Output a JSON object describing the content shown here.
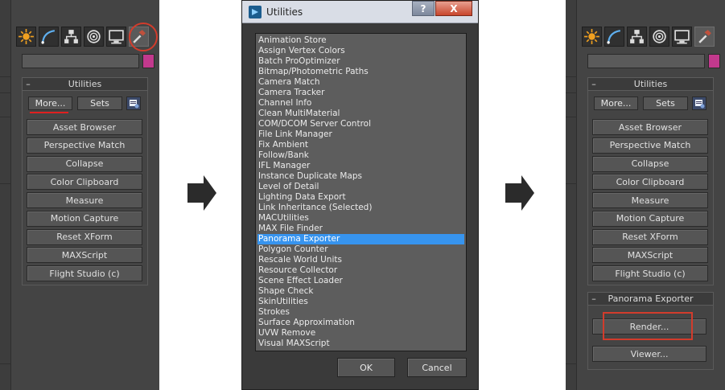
{
  "panel_left": {
    "rollout_title": "Utilities",
    "more_label": "More...",
    "sets_label": "Sets",
    "buttons": [
      "Asset Browser",
      "Perspective Match",
      "Collapse",
      "Color Clipboard",
      "Measure",
      "Motion Capture",
      "Reset XForm",
      "MAXScript",
      "Flight Studio (c)"
    ]
  },
  "dialog": {
    "title": "Utilities",
    "help_label": "?",
    "close_label": "X",
    "items": [
      "Animation Store",
      "Assign Vertex Colors",
      "Batch ProOptimizer",
      "Bitmap/Photometric Paths",
      "Camera Match",
      "Camera Tracker",
      "Channel Info",
      "Clean MultiMaterial",
      "COM/DCOM Server Control",
      "File Link Manager",
      "Fix Ambient",
      "Follow/Bank",
      "IFL Manager",
      "Instance Duplicate Maps",
      "Level of Detail",
      "Lighting Data Export",
      "Link Inheritance (Selected)",
      "MACUtilities",
      "MAX File Finder",
      "Panorama Exporter",
      "Polygon Counter",
      "Rescale World Units",
      "Resource Collector",
      "Scene Effect Loader",
      "Shape Check",
      "SkinUtilities",
      "Strokes",
      "Surface Approximation",
      "UVW Remove",
      "Visual MAXScript"
    ],
    "selected_item": "Panorama Exporter",
    "ok_label": "OK",
    "cancel_label": "Cancel"
  },
  "panel_right": {
    "rollout_title": "Utilities",
    "more_label": "More...",
    "sets_label": "Sets",
    "buttons": [
      "Asset Browser",
      "Perspective Match",
      "Collapse",
      "Color Clipboard",
      "Measure",
      "Motion Capture",
      "Reset XForm",
      "MAXScript",
      "Flight Studio (c)"
    ],
    "panorama_title": "Panorama Exporter",
    "render_label": "Render...",
    "viewer_label": "Viewer..."
  },
  "colors": {
    "panel_bg": "#444444",
    "selection": "#3794ee",
    "highlight_red": "#d23c2c",
    "swatch": "#c2398d"
  },
  "tab_icons": [
    "create-icon",
    "modify-icon",
    "hierarchy-icon",
    "motion-icon",
    "display-icon",
    "utilities-icon"
  ]
}
